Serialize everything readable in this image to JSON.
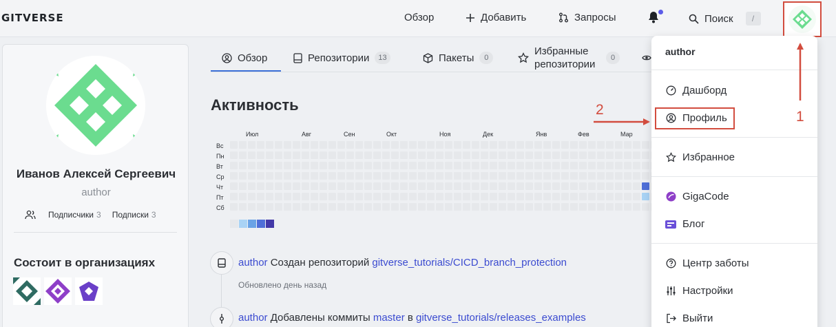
{
  "brand": {
    "logo": "GITVERSE"
  },
  "topnav": {
    "overview": "Обзор",
    "add": "Добавить",
    "requests": "Запросы",
    "search": "Поиск",
    "search_kbd": "/"
  },
  "profile": {
    "name": "Иванов Алексей Сергеевич",
    "login": "author",
    "followers_label": "Подписчики",
    "followers_count": "3",
    "following_label": "Подписки",
    "following_count": "3",
    "orgs_title": "Состоит в организациях"
  },
  "tabs": [
    {
      "label": "Обзор",
      "badge": ""
    },
    {
      "label": "Репозитории",
      "badge": "13"
    },
    {
      "label": "Пакеты",
      "badge": "0"
    },
    {
      "label": "Избранные репозитории",
      "badge": "0"
    }
  ],
  "activity": {
    "title": "Активность",
    "months": [
      "Июл",
      "Авг",
      "Сен",
      "Окт",
      "Ноя",
      "Дек",
      "Янв",
      "Фев",
      "Мар"
    ],
    "days": [
      "Вс",
      "Пн",
      "Вт",
      "Ср",
      "Чт",
      "Пт",
      "Сб"
    ],
    "legend_colors": [
      "#e6e8eb",
      "#a9d3f5",
      "#6aa3e6",
      "#4f6fd8",
      "#4339a8"
    ]
  },
  "feed": [
    {
      "user": "author",
      "action": "Создан репозиторий",
      "target": "gitverse_tutorials/CICD_branch_protection",
      "sub": "Обновлено день назад"
    },
    {
      "user": "author",
      "action": "Добавлены коммиты",
      "branch": "master",
      "in": "в",
      "target": "gitverse_tutorials/releases_examples"
    }
  ],
  "menu": {
    "header": "author",
    "items": {
      "dashboard": "Дашборд",
      "profile": "Профиль",
      "favorites": "Избранное",
      "gigacode": "GigaCode",
      "blog": "Блог",
      "help": "Центр заботы",
      "settings": "Настройки",
      "logout": "Выйти"
    }
  },
  "annotations": {
    "one": "1",
    "two": "2"
  },
  "colors": {
    "accent": "#3b6fd8",
    "link": "#3b4bd0",
    "annotation": "#d24c3e",
    "avatar_green": "#6bdc8f"
  }
}
